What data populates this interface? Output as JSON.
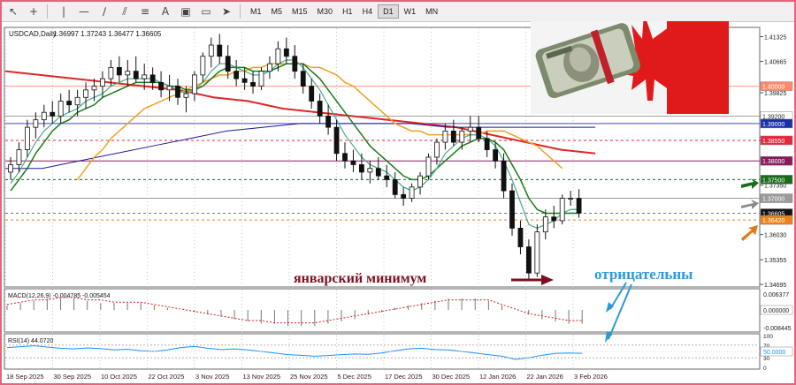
{
  "toolbar": {
    "icons": [
      "cursor-icon",
      "crosshair-icon",
      "vertical-line-icon",
      "horizontal-line-icon",
      "trendline-icon",
      "equidistant-channel-icon",
      "fibonacci-icon",
      "text-icon",
      "text-label-icon",
      "rectangle-icon",
      "arrow-icon"
    ],
    "timeframes": [
      "M1",
      "M5",
      "M15",
      "M30",
      "H1",
      "H4",
      "D1",
      "W1",
      "MN"
    ],
    "active_timeframe": "D1"
  },
  "chart_data": {
    "type": "candlestick",
    "title": "USDCAD,Daily",
    "ohlc_label": "1.36997 1.37243 1.36477 1.36605",
    "y_ticks": [
      "1.41325",
      "1.40665",
      "1.39825",
      "1.39200",
      "1.38550",
      "1.37350",
      "1.36030",
      "1.35355",
      "1.34695"
    ],
    "ylim": [
      1.3465,
      1.4155
    ],
    "x_labels": [
      "18 Sep 2025",
      "30 Sep 2025",
      "10 Oct 2025",
      "22 Oct 2025",
      "3 Nov 2025",
      "13 Nov 2025",
      "25 Nov 2025",
      "5 Dec 2025",
      "17 Dec 2025",
      "30 Dec 2025",
      "12 Jan 2026",
      "22 Jan 2026",
      "3 Feb 2026"
    ],
    "candles": [
      [
        1.377,
        1.381,
        1.375,
        1.379
      ],
      [
        1.379,
        1.385,
        1.377,
        1.383
      ],
      [
        1.383,
        1.391,
        1.381,
        1.389
      ],
      [
        1.389,
        1.393,
        1.386,
        1.391
      ],
      [
        1.391,
        1.395,
        1.389,
        1.393
      ],
      [
        1.393,
        1.396,
        1.39,
        1.392
      ],
      [
        1.392,
        1.398,
        1.39,
        1.396
      ],
      [
        1.396,
        1.399,
        1.393,
        1.395
      ],
      [
        1.395,
        1.399,
        1.392,
        1.397
      ],
      [
        1.397,
        1.401,
        1.394,
        1.399
      ],
      [
        1.399,
        1.402,
        1.396,
        1.4
      ],
      [
        1.4,
        1.404,
        1.397,
        1.402
      ],
      [
        1.402,
        1.407,
        1.4,
        1.405
      ],
      [
        1.405,
        1.408,
        1.401,
        1.403
      ],
      [
        1.403,
        1.407,
        1.4,
        1.404
      ],
      [
        1.404,
        1.408,
        1.401,
        1.402
      ],
      [
        1.402,
        1.406,
        1.399,
        1.403
      ],
      [
        1.403,
        1.405,
        1.399,
        1.401
      ],
      [
        1.401,
        1.404,
        1.397,
        1.399
      ],
      [
        1.399,
        1.403,
        1.396,
        1.4
      ],
      [
        1.4,
        1.402,
        1.395,
        1.397
      ],
      [
        1.397,
        1.4,
        1.393,
        1.398
      ],
      [
        1.398,
        1.404,
        1.396,
        1.403
      ],
      [
        1.403,
        1.409,
        1.401,
        1.408
      ],
      [
        1.408,
        1.413,
        1.405,
        1.411
      ],
      [
        1.411,
        1.414,
        1.406,
        1.408
      ],
      [
        1.408,
        1.411,
        1.402,
        1.404
      ],
      [
        1.404,
        1.407,
        1.4,
        1.402
      ],
      [
        1.402,
        1.405,
        1.399,
        1.401
      ],
      [
        1.401,
        1.404,
        1.398,
        1.4
      ],
      [
        1.4,
        1.405,
        1.399,
        1.404
      ],
      [
        1.404,
        1.408,
        1.402,
        1.406
      ],
      [
        1.406,
        1.412,
        1.404,
        1.41
      ],
      [
        1.41,
        1.413,
        1.406,
        1.408
      ],
      [
        1.408,
        1.411,
        1.402,
        1.404
      ],
      [
        1.404,
        1.406,
        1.398,
        1.4
      ],
      [
        1.4,
        1.402,
        1.394,
        1.396
      ],
      [
        1.396,
        1.398,
        1.39,
        1.392
      ],
      [
        1.392,
        1.395,
        1.387,
        1.389
      ],
      [
        1.389,
        1.391,
        1.38,
        1.382
      ],
      [
        1.382,
        1.385,
        1.378,
        1.38
      ],
      [
        1.38,
        1.383,
        1.377,
        1.379
      ],
      [
        1.379,
        1.382,
        1.375,
        1.377
      ],
      [
        1.377,
        1.38,
        1.374,
        1.378
      ],
      [
        1.378,
        1.381,
        1.375,
        1.376
      ],
      [
        1.376,
        1.379,
        1.373,
        1.375
      ],
      [
        1.375,
        1.377,
        1.37,
        1.371
      ],
      [
        1.371,
        1.373,
        1.368,
        1.37
      ],
      [
        1.37,
        1.374,
        1.369,
        1.373
      ],
      [
        1.373,
        1.377,
        1.371,
        1.376
      ],
      [
        1.376,
        1.382,
        1.375,
        1.381
      ],
      [
        1.381,
        1.386,
        1.379,
        1.385
      ],
      [
        1.385,
        1.39,
        1.383,
        1.388
      ],
      [
        1.388,
        1.391,
        1.384,
        1.385
      ],
      [
        1.385,
        1.389,
        1.383,
        1.388
      ],
      [
        1.388,
        1.392,
        1.385,
        1.389
      ],
      [
        1.389,
        1.392,
        1.385,
        1.386
      ],
      [
        1.386,
        1.388,
        1.381,
        1.383
      ],
      [
        1.383,
        1.385,
        1.378,
        1.38
      ],
      [
        1.38,
        1.382,
        1.37,
        1.372
      ],
      [
        1.372,
        1.374,
        1.36,
        1.362
      ],
      [
        1.362,
        1.364,
        1.355,
        1.357
      ],
      [
        1.357,
        1.359,
        1.348,
        1.35
      ],
      [
        1.35,
        1.363,
        1.349,
        1.361
      ],
      [
        1.361,
        1.367,
        1.359,
        1.365
      ],
      [
        1.365,
        1.368,
        1.362,
        1.364
      ],
      [
        1.364,
        1.371,
        1.363,
        1.37
      ],
      [
        1.37,
        1.372,
        1.368,
        1.37
      ],
      [
        1.36997,
        1.37243,
        1.36477,
        1.36605
      ]
    ],
    "ma_fast": [
      1.374,
      1.377,
      1.381,
      1.385,
      1.388,
      1.39,
      1.392,
      1.393,
      1.394,
      1.396,
      1.397,
      1.398,
      1.4,
      1.401,
      1.402,
      1.402,
      1.402,
      1.402,
      1.401,
      1.4,
      1.399,
      1.398,
      1.399,
      1.401,
      1.404,
      1.406,
      1.406,
      1.405,
      1.404,
      1.403,
      1.403,
      1.404,
      1.406,
      1.407,
      1.407,
      1.405,
      1.402,
      1.399,
      1.395,
      1.391,
      1.387,
      1.384,
      1.381,
      1.379,
      1.378,
      1.377,
      1.375,
      1.373,
      1.372,
      1.373,
      1.375,
      1.378,
      1.382,
      1.384,
      1.386,
      1.387,
      1.387,
      1.386,
      1.384,
      1.38,
      1.375,
      1.369,
      1.363,
      1.362,
      1.363,
      1.364,
      1.366,
      1.367,
      1.367
    ],
    "ma_slow": [
      1.372,
      1.375,
      1.378,
      1.382,
      1.385,
      1.388,
      1.39,
      1.391,
      1.393,
      1.394,
      1.395,
      1.397,
      1.398,
      1.399,
      1.4,
      1.401,
      1.401,
      1.401,
      1.401,
      1.4,
      1.4,
      1.399,
      1.399,
      1.4,
      1.402,
      1.404,
      1.405,
      1.405,
      1.405,
      1.404,
      1.404,
      1.404,
      1.405,
      1.406,
      1.406,
      1.406,
      1.404,
      1.402,
      1.399,
      1.396,
      1.393,
      1.39,
      1.387,
      1.384,
      1.382,
      1.38,
      1.378,
      1.376,
      1.375,
      1.375,
      1.376,
      1.378,
      1.38,
      1.382,
      1.384,
      1.385,
      1.386,
      1.386,
      1.385,
      1.383,
      1.379,
      1.375,
      1.37,
      1.367,
      1.366,
      1.366,
      1.366,
      1.366,
      1.366
    ],
    "ma_orange": [
      1.375,
      1.378,
      1.381,
      1.383,
      1.386,
      1.388,
      1.39,
      1.392,
      1.394,
      1.395,
      1.396,
      1.397,
      1.398,
      1.399,
      1.4,
      1.401,
      1.402,
      1.403,
      1.403,
      1.404,
      1.404,
      1.405,
      1.405,
      1.406,
      1.406,
      1.406,
      1.406,
      1.406,
      1.405,
      1.405,
      1.404,
      1.403,
      1.401,
      1.4,
      1.398,
      1.396,
      1.394,
      1.392,
      1.39,
      1.389,
      1.388,
      1.388,
      1.387,
      1.387,
      1.387,
      1.387,
      1.387,
      1.387,
      1.387,
      1.388,
      1.388,
      1.388,
      1.387,
      1.386,
      1.385,
      1.384,
      1.382,
      1.38,
      1.378
    ],
    "ma_red": [
      1.404,
      1.403,
      1.402,
      1.401,
      1.4,
      1.399,
      1.397,
      1.396,
      1.394,
      1.393,
      1.392,
      1.391,
      1.39,
      1.389,
      1.387,
      1.385,
      1.383,
      1.382
    ],
    "ma_blue": [
      1.378,
      1.378,
      1.38,
      1.382,
      1.384,
      1.386,
      1.388,
      1.389,
      1.39,
      1.39,
      1.39,
      1.39,
      1.389,
      1.389,
      1.389,
      1.389,
      1.389
    ],
    "levels": [
      {
        "value": 1.4,
        "label": "1.40000",
        "color": "#ff8a6a",
        "line_color": "#ff9a80",
        "dashed": false,
        "label_fg": "#ffffff"
      },
      {
        "value": 1.392,
        "label": "1.39200",
        "color": "#ffffff",
        "line_color": "#a0a0a0",
        "dashed": false,
        "label_fg": "#222222"
      },
      {
        "value": 1.39,
        "label": "1.39000",
        "color": "#1a2fa8",
        "line_color": "#4a4ab0",
        "dashed": false,
        "label_fg": "#ffffff"
      },
      {
        "value": 1.3855,
        "label": "1.38550",
        "color": "#e8263c",
        "line_color": "#e8263c",
        "dashed": true,
        "label_fg": "#ffffff"
      },
      {
        "value": 1.38,
        "label": "1.38000",
        "color": "#8a1a5c",
        "line_color": "#8a1a5c",
        "dashed": false,
        "label_fg": "#ffffff"
      },
      {
        "value": 1.375,
        "label": "1.37500",
        "color": "#1a6a1a",
        "line_color": "#1a6a1a",
        "dashed": true,
        "label_fg": "#ffffff"
      },
      {
        "value": 1.37,
        "label": "1.37000",
        "color": "#9a9a9a",
        "line_color": "#9a9a9a",
        "dashed": false,
        "label_fg": "#ffffff"
      },
      {
        "value": 1.366,
        "label": "1.36605",
        "color": "#111111",
        "line_color": "#777777",
        "dashed": true,
        "label_fg": "#ffffff"
      },
      {
        "value": 1.3642,
        "label": "1.36420",
        "color": "#e8821a",
        "line_color": "#e8821a",
        "dashed": true,
        "label_fg": "#ffffff"
      }
    ],
    "annotations": {
      "january_low": "январский минимум",
      "negative": "отрицательны"
    },
    "macd": {
      "label": "MACD(12,26,9) -0.004785 -0.005454",
      "ticks": [
        "0.006377",
        "0.000000",
        "-0.008445"
      ],
      "histogram": [
        2,
        3,
        4,
        5,
        5,
        5,
        4,
        3,
        3,
        3,
        3,
        2,
        1,
        0,
        -1,
        -2,
        -3,
        -4,
        -5,
        -6,
        -6,
        -7,
        -7,
        -7,
        -6,
        -5,
        -4,
        -2,
        -1,
        1,
        2,
        3,
        4,
        5,
        5,
        5,
        4,
        2,
        0,
        -2,
        -4,
        -5,
        -6,
        -6
      ],
      "signal": [
        2,
        3,
        4,
        4,
        5,
        5,
        4,
        4,
        3,
        3,
        3,
        2,
        1,
        0,
        -1,
        -2,
        -3,
        -4,
        -5,
        -5,
        -6,
        -6,
        -6,
        -6,
        -5,
        -4,
        -3,
        -2,
        -1,
        0,
        1,
        2,
        3,
        4,
        4,
        4,
        4,
        2,
        0,
        -2,
        -3,
        -4,
        -5,
        -5
      ]
    },
    "rsi": {
      "label": "RSI(14) 44.0720",
      "ticks": [
        "100",
        "70",
        "30",
        "0"
      ],
      "right_label": "50.0000",
      "values": [
        62,
        65,
        68,
        64,
        60,
        58,
        61,
        59,
        55,
        57,
        52,
        50,
        55,
        62,
        66,
        60,
        56,
        58,
        55,
        50,
        45,
        40,
        38,
        35,
        37,
        40,
        42,
        41,
        45,
        52,
        58,
        60,
        56,
        55,
        50,
        45,
        40,
        35,
        25,
        30,
        38,
        44,
        45,
        44
      ]
    }
  }
}
